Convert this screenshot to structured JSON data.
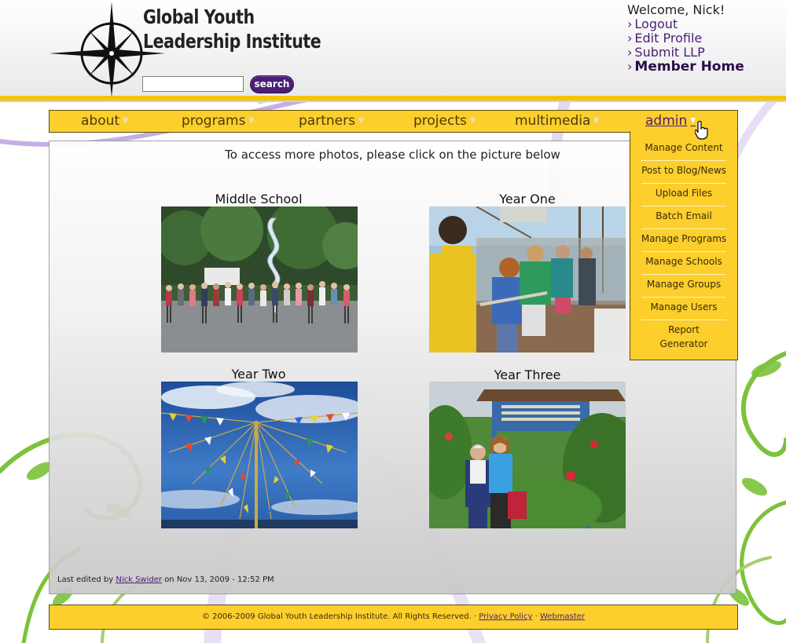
{
  "site": {
    "logo_line1": "Global Youth",
    "logo_line2": "Leadership Institute"
  },
  "search": {
    "button_label": "search",
    "placeholder": ""
  },
  "user_menu": {
    "welcome": "Welcome, Nick!",
    "links": [
      "Logout",
      "Edit Profile",
      "Submit LLP",
      "Member Home"
    ]
  },
  "nav": {
    "items": [
      "about",
      "programs",
      "partners",
      "projects",
      "multimedia",
      "admin"
    ],
    "active": "admin"
  },
  "admin_menu": {
    "items": [
      "Manage Content",
      "Post to Blog/News",
      "Upload Files",
      "Batch Email",
      "Manage Programs",
      "Manage Schools",
      "Manage Groups",
      "Manage Users",
      "Report",
      "Generator"
    ]
  },
  "content": {
    "intro": "To access more photos, please click on the picture below",
    "galleries": [
      {
        "title": "Middle School"
      },
      {
        "title": "Year One"
      },
      {
        "title": "Year Two"
      },
      {
        "title": "Year Three"
      }
    ],
    "last_edited_prefix": "Last edited by",
    "last_edited_user": "Nick Swider",
    "last_edited_suffix": "on Nov 13, 2009 - 12:52 PM"
  },
  "footer": {
    "copyright": "© 2006-2009 Global Youth Leadership Institute. All Rights Reserved.",
    "sep": "·",
    "privacy_label": "Privacy Policy",
    "webmaster_label": "Webmaster"
  },
  "colors": {
    "accent_yellow": "#fccf2c",
    "brand_purple": "#4b1f74",
    "swirl_green": "#6ab42e",
    "swirl_violet": "#c9b3e6"
  },
  "icons": [
    "compass-star-logo",
    "chevron-down-icon",
    "hand-pointer-cursor"
  ]
}
